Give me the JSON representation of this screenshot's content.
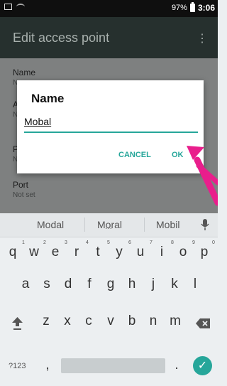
{
  "status_bar": {
    "battery": "97%",
    "time": "3:06"
  },
  "app_bar": {
    "title": "Edit access point",
    "more_icon": "⋮"
  },
  "list": [
    {
      "label": "Name",
      "value": "N"
    },
    {
      "label": "A",
      "value": "N"
    },
    {
      "label": "P",
      "value": "N"
    },
    {
      "label": "Port",
      "value": "Not set"
    }
  ],
  "dialog": {
    "title": "Name",
    "input_value": "Mobal",
    "cancel_label": "CANCEL",
    "ok_label": "OK"
  },
  "colors": {
    "accent": "#26a69a",
    "arrow": "#e91e8c"
  },
  "keyboard": {
    "suggestions": [
      "Modal",
      "Moral",
      "Mobil"
    ],
    "row1": [
      "q",
      "w",
      "e",
      "r",
      "t",
      "y",
      "u",
      "i",
      "o",
      "p"
    ],
    "row1_hints": [
      "1",
      "2",
      "3",
      "4",
      "5",
      "6",
      "7",
      "8",
      "9",
      "0"
    ],
    "row2": [
      "a",
      "s",
      "d",
      "f",
      "g",
      "h",
      "j",
      "k",
      "l"
    ],
    "row3": [
      "z",
      "x",
      "c",
      "v",
      "b",
      "n",
      "m"
    ],
    "symbols_label": "?123",
    "comma": ",",
    "period": ".",
    "enter_icon": "✓",
    "shift_icon": "shift-icon",
    "backspace_icon": "backspace-icon",
    "mic_icon": "mic-icon"
  }
}
